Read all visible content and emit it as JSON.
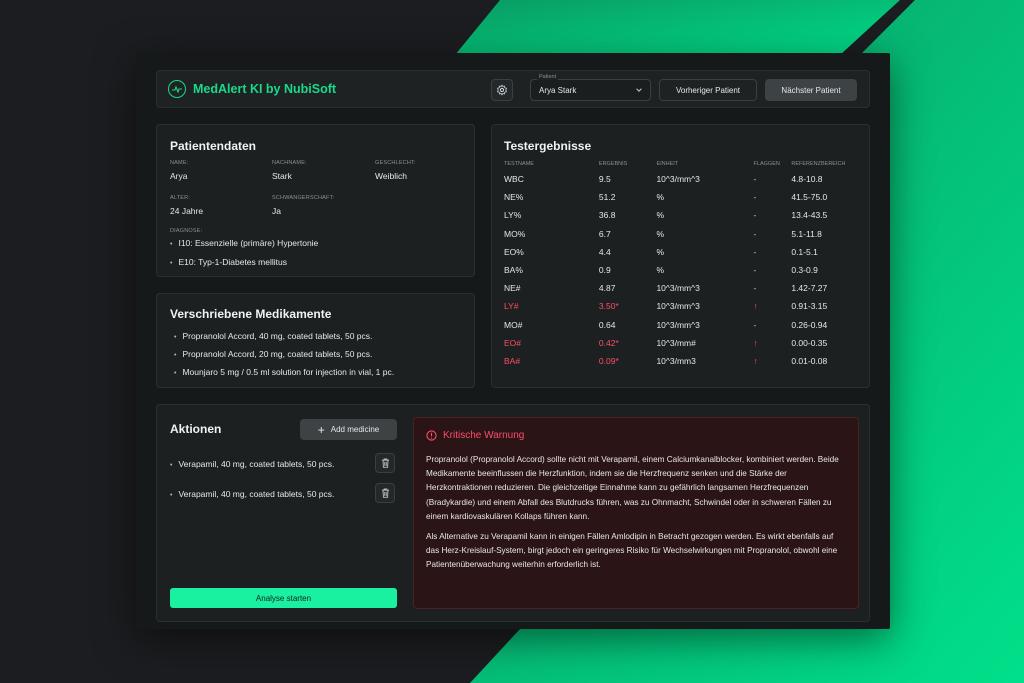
{
  "header": {
    "brand": "MedAlert KI by NubiSoft",
    "patient_legend": "Patient",
    "patient_value": "Arya Stark",
    "prev_label": "Vorheriger Patient",
    "next_label": "Nächster Patient"
  },
  "patient": {
    "title": "Patientendaten",
    "fields": [
      {
        "label": "NAME:",
        "value": "Arya"
      },
      {
        "label": "NACHNAME:",
        "value": "Stark"
      },
      {
        "label": "GESCHLECHT:",
        "value": "Weiblich"
      },
      {
        "label": "ALTER:",
        "value": "24 Jahre"
      },
      {
        "label": "SCHWANGERSCHAFT:",
        "value": "Ja"
      }
    ],
    "diagnosis_label": "DIAGNOSE:",
    "diagnoses": [
      "I10: Essenzielle (primäre) Hypertonie",
      "E10: Typ-1-Diabetes mellitus"
    ]
  },
  "medications": {
    "title": "Verschriebene Medikamente",
    "items": [
      "Propranolol Accord, 40 mg, coated tablets, 50 pcs.",
      "Propranolol Accord, 20 mg, coated tablets, 50 pcs.",
      "Mounjaro 5 mg / 0.5 ml solution for injection in vial, 1 pc."
    ]
  },
  "tests": {
    "title": "Testergebnisse",
    "columns": [
      "TESTNAME",
      "ERGEBNIS",
      "EINHEIT",
      "FLAGGEN",
      "REFERENZBEREICH"
    ],
    "rows": [
      {
        "name": "WBC",
        "result": "9.5",
        "unit": "10^3/mm^3",
        "flag": "-",
        "ref": "4.8-10.8",
        "alert": false
      },
      {
        "name": "NE%",
        "result": "51.2",
        "unit": "%",
        "flag": "-",
        "ref": "41.5-75.0",
        "alert": false
      },
      {
        "name": "LY%",
        "result": "36.8",
        "unit": "%",
        "flag": "-",
        "ref": "13.4-43.5",
        "alert": false
      },
      {
        "name": "MO%",
        "result": "6.7",
        "unit": "%",
        "flag": "-",
        "ref": "5.1-11.8",
        "alert": false
      },
      {
        "name": "EO%",
        "result": "4.4",
        "unit": "%",
        "flag": "-",
        "ref": "0.1-5.1",
        "alert": false
      },
      {
        "name": "BA%",
        "result": "0.9",
        "unit": "%",
        "flag": "-",
        "ref": "0.3-0.9",
        "alert": false
      },
      {
        "name": "NE#",
        "result": "4.87",
        "unit": "10^3/mm^3",
        "flag": "-",
        "ref": "1.42-7.27",
        "alert": false
      },
      {
        "name": "LY#",
        "result": "3.50*",
        "unit": "10^3/mm^3",
        "flag": "↑",
        "ref": "0.91-3.15",
        "alert": true
      },
      {
        "name": "MO#",
        "result": "0.64",
        "unit": "10^3/mm^3",
        "flag": "-",
        "ref": "0.26-0.94",
        "alert": false
      },
      {
        "name": "EO#",
        "result": "0.42*",
        "unit": "10^3/mm#",
        "flag": "↑",
        "ref": "0.00-0.35",
        "alert": true
      },
      {
        "name": "BA#",
        "result": "0.09*",
        "unit": "10^3/mm3",
        "flag": "↑",
        "ref": "0.01-0.08",
        "alert": true
      }
    ]
  },
  "actions": {
    "title": "Aktionen",
    "add_label": "Add medicine",
    "items": [
      "Verapamil, 40 mg, coated tablets, 50 pcs.",
      "Verapamil, 40 mg, coated tablets, 50 pcs."
    ],
    "analyse_label": "Analyse starten"
  },
  "warning": {
    "title": "Kritische Warnung",
    "paragraphs": [
      "Propranolol (Propranolol Accord) sollte nicht mit Verapamil, einem Calciumkanalblocker, kombiniert werden. Beide Medikamente beeinflussen die Herzfunktion, indem sie die Herzfrequenz senken und die Stärke der Herzkontraktionen reduzieren. Die gleichzeitige Einnahme kann zu gefährlich langsamen Herzfrequenzen (Bradykardie) und einem Abfall des Blutdrucks führen, was zu Ohnmacht, Schwindel oder in schweren Fällen zu einem kardiovaskulären Kollaps führen kann.",
      "Als Alternative zu Verapamil kann in einigen Fällen Amlodipin in Betracht gezogen werden. Es wirkt ebenfalls auf das Herz-Kreislauf-System, birgt jedoch ein geringeres Risiko für Wechselwirkungen mit Propranolol, obwohl eine Patientenüberwachung weiterhin erforderlich ist."
    ]
  },
  "colors": {
    "accent": "#19f0a0",
    "alert": "#ff4d6a"
  }
}
